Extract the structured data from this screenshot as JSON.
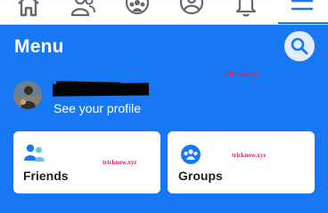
{
  "nav": {
    "items": [
      {
        "name": "home-icon"
      },
      {
        "name": "friends-icon"
      },
      {
        "name": "groups-icon"
      },
      {
        "name": "profile-icon"
      },
      {
        "name": "notifications-icon"
      },
      {
        "name": "menu-icon",
        "active": true
      }
    ]
  },
  "header": {
    "title": "Menu"
  },
  "watermark": "tricknow.xyz",
  "profile": {
    "see_profile_label": "See your profile"
  },
  "cards": [
    {
      "label": "Friends",
      "icon": "friends-icon"
    },
    {
      "label": "Groups",
      "icon": "groups-icon"
    }
  ],
  "colors": {
    "brand": "#1877F2",
    "nav_icon": "#65676B",
    "watermark": "#E0245E"
  }
}
